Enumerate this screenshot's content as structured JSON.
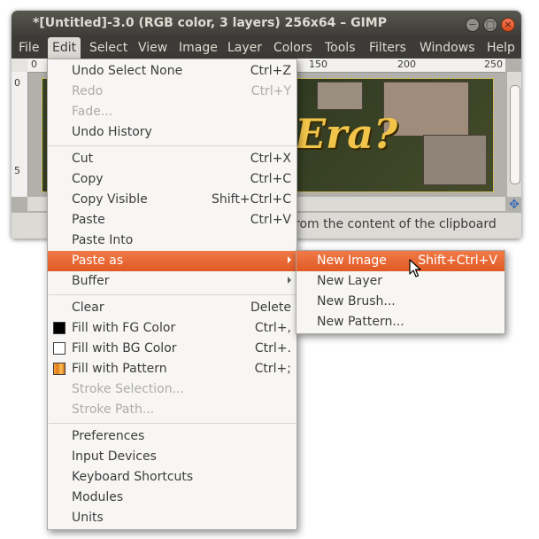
{
  "window": {
    "title": "*[Untitled]-3.0 (RGB color, 3 layers) 256x64 – GIMP",
    "controls": {
      "minimize": "−",
      "maximize": "□",
      "close": "×"
    }
  },
  "menubar": [
    "File",
    "Edit",
    "Select",
    "View",
    "Image",
    "Layer",
    "Colors",
    "Tools",
    "Filters",
    "Windows",
    "Help"
  ],
  "ruler": {
    "h_labels": [
      "0",
      "150",
      "200",
      "250"
    ],
    "v_labels": [
      "0",
      "5"
    ]
  },
  "canvas": {
    "image_text": "Era?"
  },
  "status": {
    "text": "rom the content of the clipboard"
  },
  "edit_menu": [
    {
      "label": "Undo Select None",
      "shortcut": "Ctrl+Z",
      "enabled": true
    },
    {
      "label": "Redo",
      "shortcut": "Ctrl+Y",
      "enabled": false
    },
    {
      "label": "Fade...",
      "shortcut": "",
      "enabled": false
    },
    {
      "label": "Undo History",
      "shortcut": "",
      "enabled": true
    },
    {
      "label": "Cut",
      "shortcut": "Ctrl+X",
      "enabled": true
    },
    {
      "label": "Copy",
      "shortcut": "Ctrl+C",
      "enabled": true
    },
    {
      "label": "Copy Visible",
      "shortcut": "Shift+Ctrl+C",
      "enabled": true
    },
    {
      "label": "Paste",
      "shortcut": "Ctrl+V",
      "enabled": true
    },
    {
      "label": "Paste Into",
      "shortcut": "",
      "enabled": true
    },
    {
      "label": "Paste as",
      "shortcut": "",
      "enabled": true,
      "submenu": true,
      "highlighted": true
    },
    {
      "label": "Buffer",
      "shortcut": "",
      "enabled": true,
      "submenu": true
    },
    {
      "label": "Clear",
      "shortcut": "Delete",
      "enabled": true
    },
    {
      "label": "Fill with FG Color",
      "shortcut": "Ctrl+,",
      "enabled": true,
      "swatch": "#000000"
    },
    {
      "label": "Fill with BG Color",
      "shortcut": "Ctrl+.",
      "enabled": true,
      "swatch": "#ffffff"
    },
    {
      "label": "Fill with Pattern",
      "shortcut": "Ctrl+;",
      "enabled": true,
      "swatch": "pattern"
    },
    {
      "label": "Stroke Selection...",
      "shortcut": "",
      "enabled": false
    },
    {
      "label": "Stroke Path...",
      "shortcut": "",
      "enabled": false
    },
    {
      "label": "Preferences",
      "shortcut": "",
      "enabled": true
    },
    {
      "label": "Input Devices",
      "shortcut": "",
      "enabled": true
    },
    {
      "label": "Keyboard Shortcuts",
      "shortcut": "",
      "enabled": true
    },
    {
      "label": "Modules",
      "shortcut": "",
      "enabled": true
    },
    {
      "label": "Units",
      "shortcut": "",
      "enabled": true
    }
  ],
  "paste_as_submenu": [
    {
      "label": "New Image",
      "shortcut": "Shift+Ctrl+V",
      "highlighted": true
    },
    {
      "label": "New Layer",
      "shortcut": ""
    },
    {
      "label": "New Brush...",
      "shortcut": ""
    },
    {
      "label": "New Pattern...",
      "shortcut": ""
    }
  ],
  "colors": {
    "accent": "#e8672f",
    "titlebar": "#3c3b37",
    "menu_bg": "#f7f6f4",
    "disabled": "#aeaca6"
  }
}
